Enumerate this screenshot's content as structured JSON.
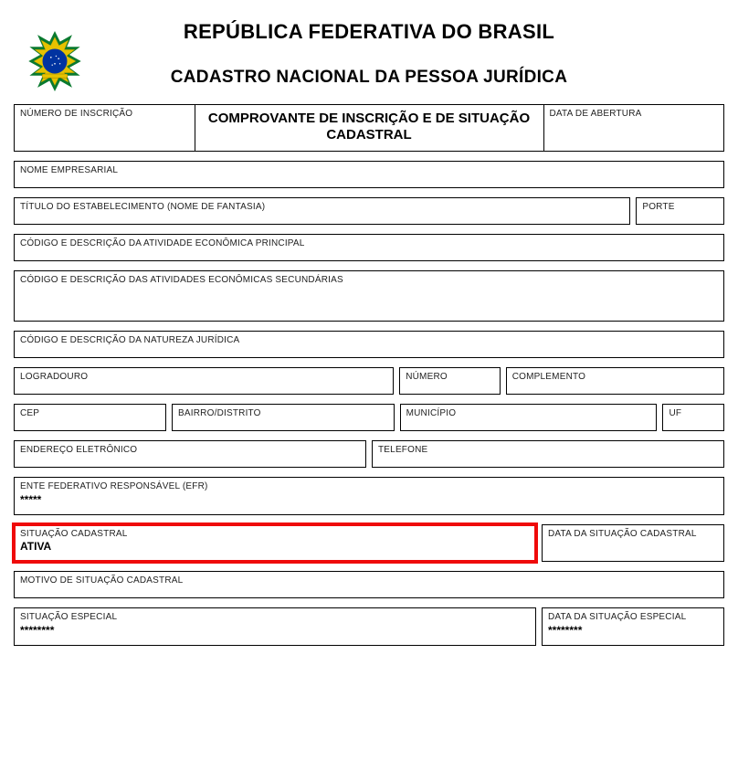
{
  "header": {
    "title": "REPÚBLICA FEDERATIVA DO BRASIL",
    "subtitle": "CADASTRO NACIONAL DA PESSOA JURÍDICA"
  },
  "fields": {
    "numero_inscricao": {
      "label": "NÚMERO DE INSCRIÇÃO",
      "value": ""
    },
    "comprovante": {
      "value": "COMPROVANTE DE INSCRIÇÃO E DE SITUAÇÃO CADASTRAL"
    },
    "data_abertura": {
      "label": "DATA DE ABERTURA",
      "value": ""
    },
    "nome_empresarial": {
      "label": "NOME EMPRESARIAL",
      "value": ""
    },
    "nome_fantasia": {
      "label": "TÍTULO DO ESTABELECIMENTO (NOME DE FANTASIA)",
      "value": ""
    },
    "porte": {
      "label": "PORTE",
      "value": ""
    },
    "atividade_principal": {
      "label": "CÓDIGO E DESCRIÇÃO DA ATIVIDADE ECONÔMICA PRINCIPAL",
      "value": ""
    },
    "atividades_secundarias": {
      "label": "CÓDIGO E DESCRIÇÃO DAS ATIVIDADES ECONÔMICAS SECUNDÁRIAS",
      "value": ""
    },
    "natureza_juridica": {
      "label": "CÓDIGO E DESCRIÇÃO DA NATUREZA JURÍDICA",
      "value": ""
    },
    "logradouro": {
      "label": "LOGRADOURO",
      "value": ""
    },
    "numero": {
      "label": "NÚMERO",
      "value": ""
    },
    "complemento": {
      "label": "COMPLEMENTO",
      "value": ""
    },
    "cep": {
      "label": "CEP",
      "value": ""
    },
    "bairro": {
      "label": "BAIRRO/DISTRITO",
      "value": ""
    },
    "municipio": {
      "label": "MUNICÍPIO",
      "value": ""
    },
    "uf": {
      "label": "UF",
      "value": ""
    },
    "email": {
      "label": "ENDEREÇO ELETRÔNICO",
      "value": ""
    },
    "telefone": {
      "label": "TELEFONE",
      "value": ""
    },
    "efr": {
      "label": "ENTE FEDERATIVO RESPONSÁVEL (EFR)",
      "value": "*****"
    },
    "situacao_cadastral": {
      "label": "SITUAÇÃO CADASTRAL",
      "value": "ATIVA"
    },
    "data_situacao_cadastral": {
      "label": "DATA DA SITUAÇÃO CADASTRAL",
      "value": ""
    },
    "motivo_situacao": {
      "label": "MOTIVO DE SITUAÇÃO CADASTRAL",
      "value": ""
    },
    "situacao_especial": {
      "label": "SITUAÇÃO ESPECIAL",
      "value": "********"
    },
    "data_situacao_especial": {
      "label": "DATA DA SITUAÇÃO ESPECIAL",
      "value": "********"
    }
  }
}
